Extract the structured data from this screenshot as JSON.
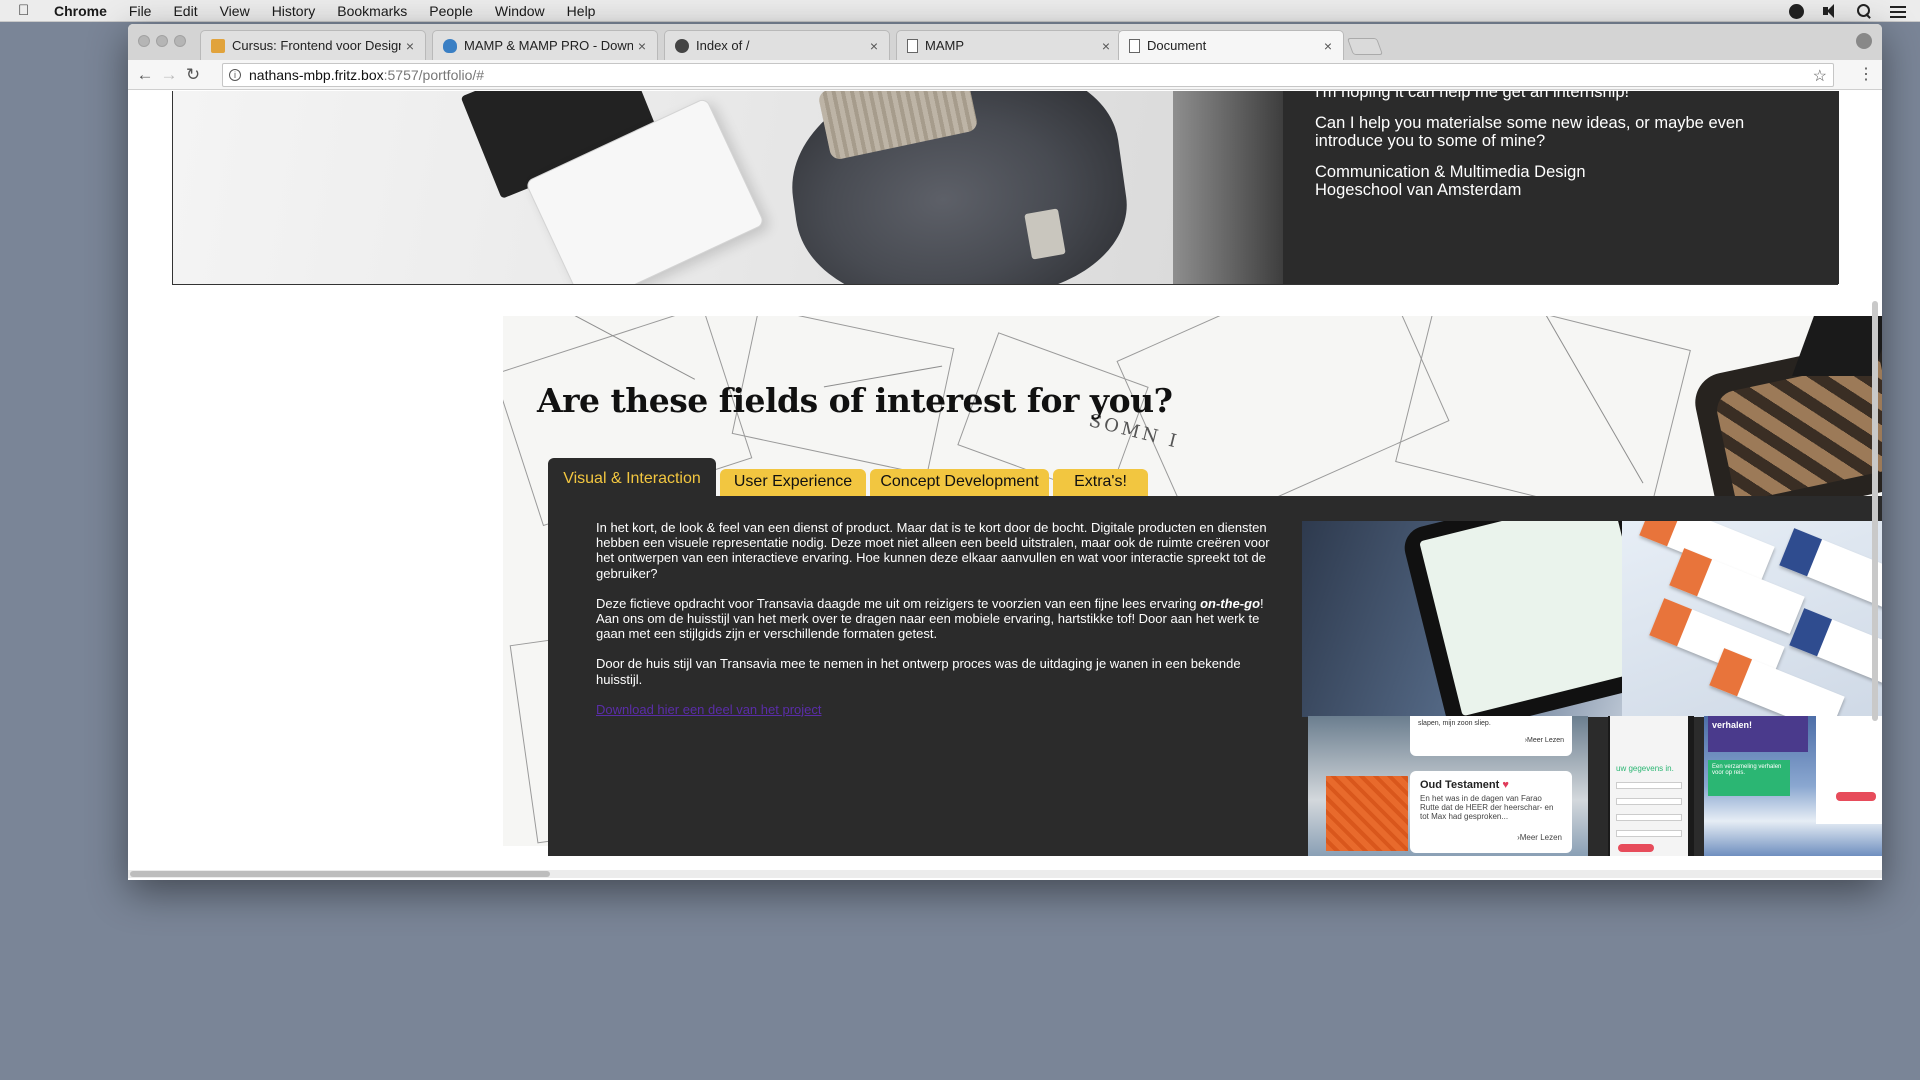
{
  "menubar": {
    "app": "Chrome",
    "items": [
      "File",
      "Edit",
      "View",
      "History",
      "Bookmarks",
      "People",
      "Window",
      "Help"
    ],
    "status_icons": [
      "dark-circle-icon",
      "speaker-icon",
      "spotlight-search-icon",
      "list-icon"
    ]
  },
  "tabs": [
    {
      "title": "Cursus: Frontend voor Designe",
      "icon": "cursus-favicon",
      "close": "×"
    },
    {
      "title": "MAMP & MAMP PRO - Downlo",
      "icon": "mamp-favicon",
      "close": "×"
    },
    {
      "title": "Index of /",
      "icon": "github-favicon",
      "close": "×"
    },
    {
      "title": "MAMP",
      "icon": "document-favicon",
      "close": "×"
    },
    {
      "title": "Document",
      "icon": "document-favicon",
      "close": "×",
      "active": true
    }
  ],
  "toolbar": {
    "back": "←",
    "forward": "→",
    "reload": "↻",
    "url_host": "nathans-mbp.fritz.box",
    "url_path": ":5757/portfolio/#",
    "info": "i",
    "bookmark_star": "☆",
    "menu": "⋮"
  },
  "hero": {
    "line1": "I'm hoping it can help me get an internship!",
    "line2": "Can I help you materialse some new ideas, or maybe even introduce you to some of mine?",
    "line3a": "Communication & Multimedia Design",
    "line3b": "Hogeschool van Amsterdam"
  },
  "interests": {
    "heading": "Are these fields of interest for you?",
    "tabs": [
      "Visual & Interaction",
      "User Experience",
      "Concept Development",
      "Extra's!"
    ],
    "active_tab": 0,
    "para1": "In het kort, de look & feel van een dienst of product. Maar dat is te kort door de bocht. Digitale producten en diensten hebben een visuele representatie nodig. Deze moet niet alleen een beeld uitstralen, maar ook de ruimte creëren voor het ontwerpen van een interactieve ervaring. Hoe kunnen deze elkaar aanvullen en wat voor interactie spreekt tot de gebruiker?",
    "para2_before": "Deze fictieve opdracht voor Transavia daagde me uit om reizigers te voorzien van een fijne lees ervaring ",
    "para2_em": "on-the-go",
    "para2_after": "! Aan ons om de huisstijl van het merk over te dragen naar een mobiele ervaring, hartstikke tof! Door aan het werk te gaan met een stijlgids zijn er verschillende formaten getest.",
    "para3": "Door de huis stijl van Transavia mee te nemen in het ontwerp proces was de uitdaging je wanen in een bekende huisstijl.",
    "link": "Download hier een deel van het project"
  },
  "screenshots": {
    "card_title": "Oud Testament",
    "card_heart": "♥",
    "card_text": "En het was in de dagen van Farao Rutte dat de HEER der heerschar- en tot Max had gesproken...",
    "card_more": "›Meer Lezen",
    "top_card_text": "slapen, mijn zoon sliep.",
    "form_label": "uw gegevens in.",
    "stories_heading": "verhalen!",
    "collection_text": "Een verzameling verhalen voor op reis."
  },
  "colors": {
    "accent_yellow": "#f2c640",
    "panel_dark": "#2b2b2b",
    "link_purple": "#5a2da8",
    "desktop_bg": "#7a8597"
  }
}
